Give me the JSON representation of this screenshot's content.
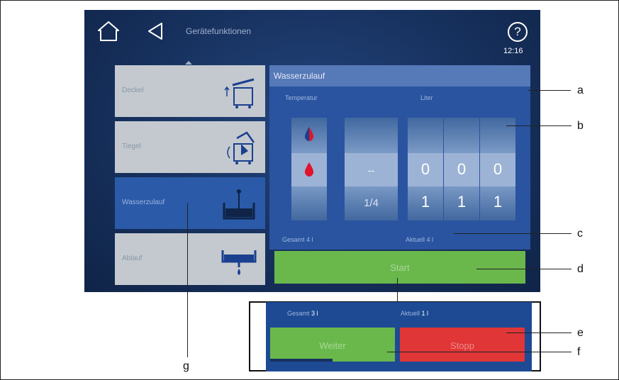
{
  "header": {
    "title": "Gerätefunktionen",
    "time": "12:16",
    "help_symbol": "?"
  },
  "menu": {
    "items": [
      {
        "label": "Deckel",
        "icon": "lid-icon"
      },
      {
        "label": "Tiegel",
        "icon": "pan-tilt-icon"
      },
      {
        "label": "Wasserzulauf",
        "icon": "water-inlet-icon",
        "active": true
      },
      {
        "label": "Ablauf",
        "icon": "drain-icon"
      }
    ]
  },
  "panel": {
    "title": "Wasserzulauf",
    "temperature_label": "Temperatur",
    "liter_label": "Liter",
    "mid_value": "--",
    "mid_next": "1/4",
    "digits": [
      "0",
      "0",
      "0"
    ],
    "digits_next": [
      "1",
      "1",
      "1"
    ],
    "total_text": "Gesamt 4 l",
    "current_text": "Aktuell 4 l",
    "start_label": "Start"
  },
  "inset": {
    "total_prefix": "Gesamt",
    "total_value": "3 l",
    "current_prefix": "Aktuell",
    "current_value": "1 l",
    "weiter_label": "Weiter",
    "stopp_label": "Stopp",
    "progress": 0.5
  },
  "callouts": [
    "a",
    "b",
    "c",
    "d",
    "e",
    "f",
    "g"
  ],
  "colors": {
    "background": "#17315e",
    "menu_item": "#c3c9cf",
    "menu_active": "#2b5aa8",
    "start_green": "#6ab84c",
    "stopp_red": "#e03638",
    "drop_red": "#e0132a",
    "drop_blue": "#1b3f8f"
  }
}
